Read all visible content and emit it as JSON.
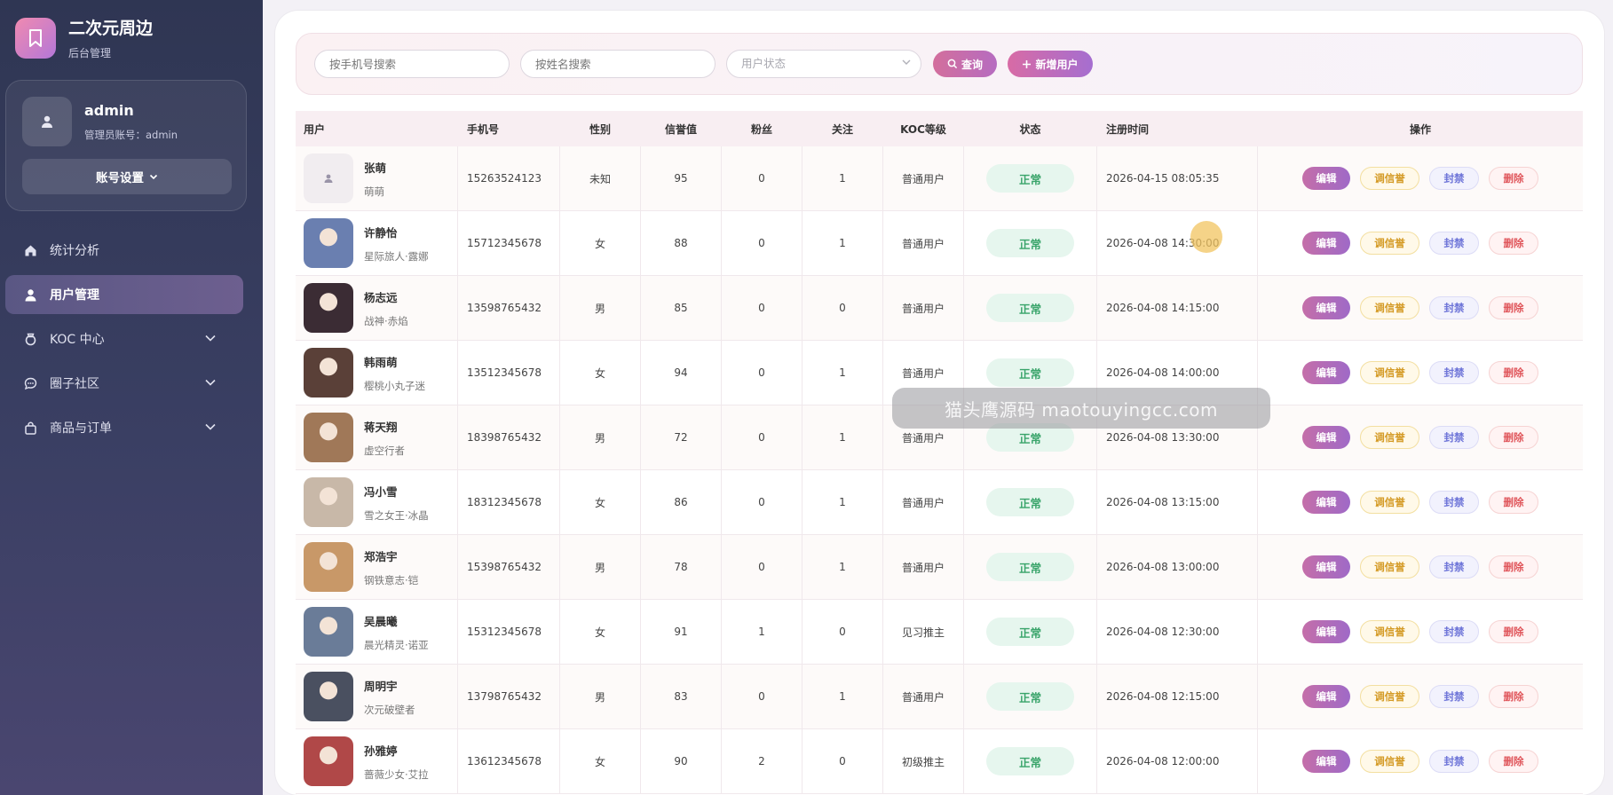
{
  "brand": {
    "title": "二次元周边",
    "subtitle": "后台管理"
  },
  "user": {
    "name": "admin",
    "account_label": "管理员账号：admin",
    "settings_label": "账号设置"
  },
  "nav": [
    {
      "label": "统计分析",
      "icon": "home-icon",
      "active": false
    },
    {
      "label": "用户管理",
      "icon": "user-icon",
      "active": true
    },
    {
      "label": "KOC 中心",
      "icon": "badge-icon",
      "active": false
    },
    {
      "label": "圈子社区",
      "icon": "chat-icon",
      "active": false
    },
    {
      "label": "商品与订单",
      "icon": "bag-icon",
      "active": false
    }
  ],
  "filters": {
    "phone_placeholder": "按手机号搜索",
    "name_placeholder": "按姓名搜索",
    "status_placeholder": "用户状态",
    "search_label": "查询",
    "add_label": "新增用户"
  },
  "table": {
    "headers": {
      "user": "用户",
      "phone": "手机号",
      "gender": "性别",
      "credit": "信誉值",
      "fans": "粉丝",
      "follow": "关注",
      "koc": "KOC等级",
      "status": "状态",
      "time": "注册时间",
      "ops": "操作"
    },
    "ops": {
      "edit": "编辑",
      "credit": "调信誉",
      "ban": "封禁",
      "delete": "删除"
    },
    "rows": [
      {
        "name": "张萌",
        "nick": "萌萌",
        "phone": "15263524123",
        "gender": "未知",
        "credit": "95",
        "fans": "0",
        "follow": "1",
        "koc": "普通用户",
        "status": "正常",
        "time": "2026-04-15 08:05:35",
        "avatar": "default"
      },
      {
        "name": "许静怡",
        "nick": "星际旅人·露娜",
        "phone": "15712345678",
        "gender": "女",
        "credit": "88",
        "fans": "0",
        "follow": "1",
        "koc": "普通用户",
        "status": "正常",
        "time": "2026-04-08 14:30:00",
        "avatar": "#6a7fb0"
      },
      {
        "name": "杨志远",
        "nick": "战神·赤焰",
        "phone": "13598765432",
        "gender": "男",
        "credit": "85",
        "fans": "0",
        "follow": "0",
        "koc": "普通用户",
        "status": "正常",
        "time": "2026-04-08 14:15:00",
        "avatar": "#3b2c34"
      },
      {
        "name": "韩雨萌",
        "nick": "樱桃小丸子迷",
        "phone": "13512345678",
        "gender": "女",
        "credit": "94",
        "fans": "0",
        "follow": "1",
        "koc": "普通用户",
        "status": "正常",
        "time": "2026-04-08 14:00:00",
        "avatar": "#5a4038"
      },
      {
        "name": "蒋天翔",
        "nick": "虚空行者",
        "phone": "18398765432",
        "gender": "男",
        "credit": "72",
        "fans": "0",
        "follow": "1",
        "koc": "普通用户",
        "status": "正常",
        "time": "2026-04-08 13:30:00",
        "avatar": "#a07858"
      },
      {
        "name": "冯小雪",
        "nick": "雪之女王·冰晶",
        "phone": "18312345678",
        "gender": "女",
        "credit": "86",
        "fans": "0",
        "follow": "1",
        "koc": "普通用户",
        "status": "正常",
        "time": "2026-04-08 13:15:00",
        "avatar": "#c8b8a8"
      },
      {
        "name": "郑浩宇",
        "nick": "钢铁意志·铠",
        "phone": "15398765432",
        "gender": "男",
        "credit": "78",
        "fans": "0",
        "follow": "1",
        "koc": "普通用户",
        "status": "正常",
        "time": "2026-04-08 13:00:00",
        "avatar": "#c89868"
      },
      {
        "name": "吴晨曦",
        "nick": "晨光精灵·诺亚",
        "phone": "15312345678",
        "gender": "女",
        "credit": "91",
        "fans": "1",
        "follow": "0",
        "koc": "见习推主",
        "status": "正常",
        "time": "2026-04-08 12:30:00",
        "avatar": "#6a7c98"
      },
      {
        "name": "周明宇",
        "nick": "次元破壁者",
        "phone": "13798765432",
        "gender": "男",
        "credit": "83",
        "fans": "0",
        "follow": "1",
        "koc": "普通用户",
        "status": "正常",
        "time": "2026-04-08 12:15:00",
        "avatar": "#4a5060"
      },
      {
        "name": "孙雅婷",
        "nick": "蔷薇少女·艾拉",
        "phone": "13612345678",
        "gender": "女",
        "credit": "90",
        "fans": "2",
        "follow": "0",
        "koc": "初级推主",
        "status": "正常",
        "time": "2026-04-08 12:00:00",
        "avatar": "#b04848"
      }
    ]
  },
  "watermark": "猫头鹰源码 maotouyingcc.com",
  "colors": {
    "accent": "#c46ea9",
    "status_ok": "#39a46a",
    "sidebar": "#2f3653"
  }
}
